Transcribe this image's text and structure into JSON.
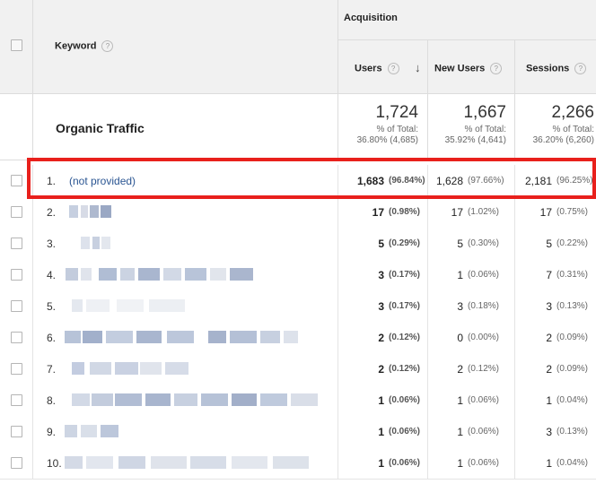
{
  "header": {
    "keyword_label": "Keyword",
    "acquisition_label": "Acquisition",
    "users_label": "Users",
    "new_users_label": "New Users",
    "sessions_label": "Sessions",
    "help_glyph": "?",
    "sort_glyph": "↓"
  },
  "totals": {
    "label": "Organic Traffic",
    "users": {
      "value": "1,724",
      "pct_line": "% of Total:",
      "total_line": "36.80% (4,685)"
    },
    "new_users": {
      "value": "1,667",
      "pct_line": "% of Total:",
      "total_line": "35.92% (4,641)"
    },
    "sessions": {
      "value": "2,266",
      "pct_line": "% of Total:",
      "total_line": "36.20% (6,260)"
    }
  },
  "rows": [
    {
      "n": "1.",
      "keyword": "(not provided)",
      "users": "1,683",
      "users_pct": "(96.84%)",
      "new_users": "1,628",
      "new_users_pct": "(97.66%)",
      "sessions": "2,181",
      "sessions_pct": "(96.25%)"
    },
    {
      "n": "2.",
      "keyword": "",
      "users": "17",
      "users_pct": "(0.98%)",
      "new_users": "17",
      "new_users_pct": "(1.02%)",
      "sessions": "17",
      "sessions_pct": "(0.75%)"
    },
    {
      "n": "3.",
      "keyword": "",
      "users": "5",
      "users_pct": "(0.29%)",
      "new_users": "5",
      "new_users_pct": "(0.30%)",
      "sessions": "5",
      "sessions_pct": "(0.22%)"
    },
    {
      "n": "4.",
      "keyword": "",
      "users": "3",
      "users_pct": "(0.17%)",
      "new_users": "1",
      "new_users_pct": "(0.06%)",
      "sessions": "7",
      "sessions_pct": "(0.31%)"
    },
    {
      "n": "5.",
      "keyword": "",
      "users": "3",
      "users_pct": "(0.17%)",
      "new_users": "3",
      "new_users_pct": "(0.18%)",
      "sessions": "3",
      "sessions_pct": "(0.13%)"
    },
    {
      "n": "6.",
      "keyword": "",
      "users": "2",
      "users_pct": "(0.12%)",
      "new_users": "0",
      "new_users_pct": "(0.00%)",
      "sessions": "2",
      "sessions_pct": "(0.09%)"
    },
    {
      "n": "7.",
      "keyword": "",
      "users": "2",
      "users_pct": "(0.12%)",
      "new_users": "2",
      "new_users_pct": "(0.12%)",
      "sessions": "2",
      "sessions_pct": "(0.09%)"
    },
    {
      "n": "8.",
      "keyword": "",
      "users": "1",
      "users_pct": "(0.06%)",
      "new_users": "1",
      "new_users_pct": "(0.06%)",
      "sessions": "1",
      "sessions_pct": "(0.04%)"
    },
    {
      "n": "9.",
      "keyword": "",
      "users": "1",
      "users_pct": "(0.06%)",
      "new_users": "1",
      "new_users_pct": "(0.06%)",
      "sessions": "3",
      "sessions_pct": "(0.13%)"
    },
    {
      "n": "10.",
      "keyword": "",
      "users": "1",
      "users_pct": "(0.06%)",
      "new_users": "1",
      "new_users_pct": "(0.06%)",
      "sessions": "1",
      "sessions_pct": "(0.04%)"
    }
  ],
  "colors": {
    "highlight": "#e8201c",
    "link": "#2a5592"
  }
}
